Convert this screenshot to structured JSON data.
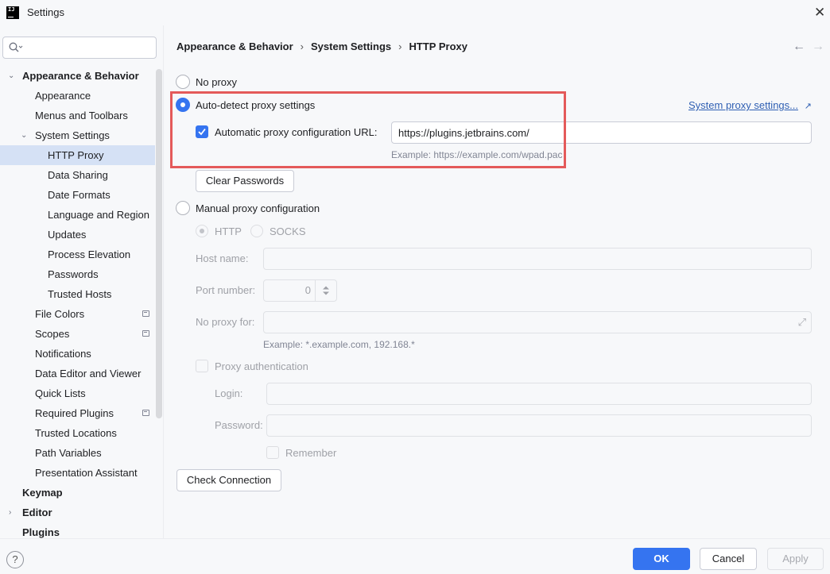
{
  "window": {
    "title": "Settings",
    "icon_text": "IJ"
  },
  "search": {
    "placeholder": ""
  },
  "sidebar": {
    "items": [
      {
        "label": "Appearance & Behavior"
      },
      {
        "label": "Appearance"
      },
      {
        "label": "Menus and Toolbars"
      },
      {
        "label": "System Settings"
      },
      {
        "label": "HTTP Proxy"
      },
      {
        "label": "Data Sharing"
      },
      {
        "label": "Date Formats"
      },
      {
        "label": "Language and Region"
      },
      {
        "label": "Updates"
      },
      {
        "label": "Process Elevation"
      },
      {
        "label": "Passwords"
      },
      {
        "label": "Trusted Hosts"
      },
      {
        "label": "File Colors"
      },
      {
        "label": "Scopes"
      },
      {
        "label": "Notifications"
      },
      {
        "label": "Data Editor and Viewer"
      },
      {
        "label": "Quick Lists"
      },
      {
        "label": "Required Plugins"
      },
      {
        "label": "Trusted Locations"
      },
      {
        "label": "Path Variables"
      },
      {
        "label": "Presentation Assistant"
      },
      {
        "label": "Keymap"
      },
      {
        "label": "Editor"
      },
      {
        "label": "Plugins"
      }
    ]
  },
  "breadcrumb": {
    "items": [
      "Appearance & Behavior",
      "System Settings",
      "HTTP Proxy"
    ]
  },
  "proxy": {
    "no_proxy_label": "No proxy",
    "auto_detect_label": "Auto-detect proxy settings",
    "system_proxy_link": "System proxy settings...",
    "auto_config_label": "Automatic proxy configuration URL:",
    "auto_config_url": "https://plugins.jetbrains.com/",
    "auto_config_example": "Example: https://example.com/wpad.pac",
    "clear_passwords": "Clear Passwords",
    "manual_label": "Manual proxy configuration",
    "http_label": "HTTP",
    "socks_label": "SOCKS",
    "host_label": "Host name:",
    "host_value": "",
    "port_label": "Port number:",
    "port_value": "0",
    "no_proxy_for_label": "No proxy for:",
    "no_proxy_for_value": "",
    "no_proxy_example": "Example: *.example.com, 192.168.*",
    "proxy_auth_label": "Proxy authentication",
    "login_label": "Login:",
    "login_value": "",
    "password_label": "Password:",
    "password_value": "",
    "remember_label": "Remember",
    "check_connection": "Check Connection"
  },
  "footer": {
    "help": "?",
    "ok": "OK",
    "cancel": "Cancel",
    "apply": "Apply"
  },
  "colors": {
    "accent": "#3574f0",
    "highlight_box": "#e45a5a",
    "selection": "#d5e1f5",
    "link": "#2f5fb3"
  }
}
